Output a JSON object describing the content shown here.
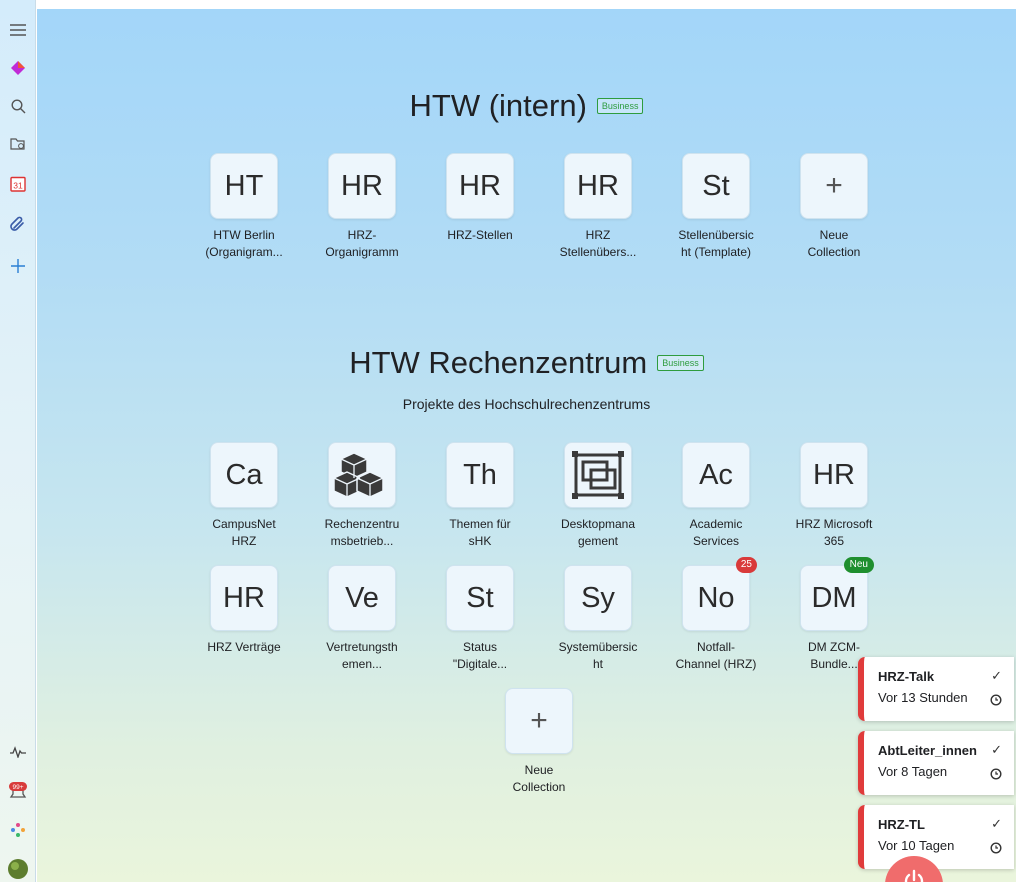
{
  "sidebar": {
    "items": [
      {
        "name": "menu-icon"
      },
      {
        "name": "gem-icon"
      },
      {
        "name": "search-icon"
      },
      {
        "name": "folder-icon"
      },
      {
        "name": "calendar-icon",
        "text": "31"
      },
      {
        "name": "paperclip-icon"
      },
      {
        "name": "add-icon"
      },
      {
        "name": "activity-icon"
      },
      {
        "name": "bell-icon",
        "text": "99+"
      },
      {
        "name": "apps-icon"
      },
      {
        "name": "avatar"
      }
    ]
  },
  "sections": [
    {
      "title": "HTW (intern)",
      "badge": "Business",
      "tiles": [
        {
          "abbr": "HT",
          "label_lines": [
            "HTW Berlin",
            "(Organigram..."
          ]
        },
        {
          "abbr": "HR",
          "label_lines": [
            "HRZ-",
            "Organigramm"
          ]
        },
        {
          "abbr": "HR",
          "label_lines": [
            "HRZ-Stellen"
          ]
        },
        {
          "abbr": "HR",
          "label_lines": [
            "HRZ",
            "Stellenübers..."
          ]
        },
        {
          "abbr": "St",
          "label_lines": [
            "Stellenübersic",
            "ht (Template)"
          ]
        },
        {
          "abbr": "+",
          "label_lines": [
            "Neue",
            "Collection"
          ]
        }
      ]
    },
    {
      "title": "HTW Rechenzentrum",
      "badge": "Business",
      "subtitle": "Projekte des Hochschulrechenzentrums",
      "tiles": [
        {
          "abbr": "Ca",
          "label_lines": [
            "CampusNet",
            "HRZ"
          ]
        },
        {
          "abbr": "",
          "icon": "cubes-icon",
          "label_lines": [
            "Rechenzentru",
            "msbetrieb..."
          ]
        },
        {
          "abbr": "Th",
          "label_lines": [
            "Themen für",
            "sHK"
          ]
        },
        {
          "abbr": "",
          "icon": "desktop-windows-icon",
          "label_lines": [
            "Desktopmana",
            "gement"
          ]
        },
        {
          "abbr": "Ac",
          "label_lines": [
            "Academic",
            "Services"
          ]
        },
        {
          "abbr": "HR",
          "label_lines": [
            "HRZ Microsoft",
            "365"
          ]
        },
        {
          "abbr": "HR",
          "label_lines": [
            "HRZ Verträge"
          ]
        },
        {
          "abbr": "Ve",
          "label_lines": [
            "Vertretungsth",
            "emen..."
          ]
        },
        {
          "abbr": "St",
          "label_lines": [
            "Status",
            "\"Digitale..."
          ]
        },
        {
          "abbr": "Sy",
          "label_lines": [
            "Systemübersic",
            "ht"
          ]
        },
        {
          "abbr": "No",
          "badge": "25",
          "label_lines": [
            "Notfall-",
            "Channel (HRZ)"
          ]
        },
        {
          "abbr": "DM",
          "new_badge": "Neu",
          "label_lines": [
            "DM ZCM-",
            "Bundle..."
          ]
        },
        {
          "abbr": "+",
          "label_lines": [
            "Neue",
            "Collection"
          ]
        }
      ]
    }
  ],
  "notifications": [
    {
      "title": "HRZ-Talk",
      "time": "Vor 13 Stunden"
    },
    {
      "title": "AbtLeiter_innen",
      "time": "Vor 8 Tagen"
    },
    {
      "title": "HRZ-TL",
      "time": "Vor 10 Tagen"
    }
  ],
  "colors": {
    "accent_red": "#e03b3b",
    "badge_green": "#2e9c3e",
    "new_green": "#1f8f2e",
    "count_red": "#d93a3a"
  }
}
